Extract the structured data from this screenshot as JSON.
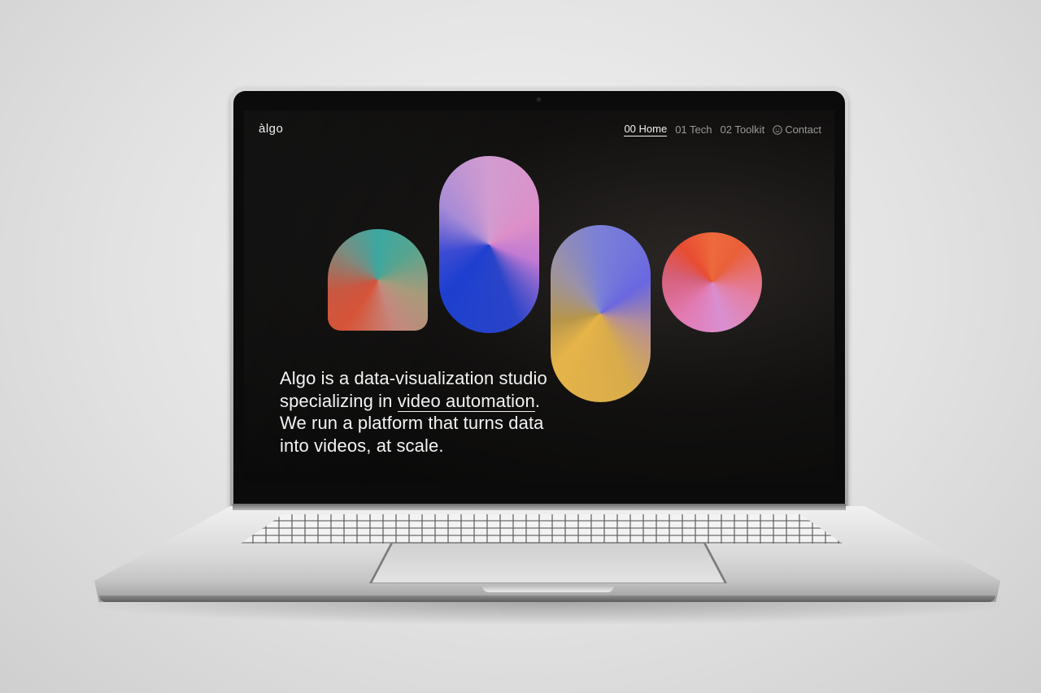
{
  "site": {
    "logo": "àlgo",
    "nav": [
      {
        "label": "00 Home",
        "active": true
      },
      {
        "label": "01 Tech",
        "active": false
      },
      {
        "label": "02 Toolkit",
        "active": false
      },
      {
        "label": "Contact",
        "active": false,
        "icon": "smile-icon"
      }
    ],
    "tagline": {
      "line1": "Algo is a data-visualization studio",
      "line2_prefix": "specializing in ",
      "line2_link": "video automation",
      "line2_suffix": ".",
      "line3": "We run a platform that turns data",
      "line4": "into videos, at scale."
    }
  },
  "colors": {
    "screen_background": "#0b0b0b",
    "text_primary": "#f3f3f3",
    "nav_inactive": "#9a9a9a"
  },
  "shapes": [
    {
      "name": "arch-shape",
      "colors": [
        "#3aa7a0",
        "#d65236"
      ]
    },
    {
      "name": "pill-shape-blue",
      "colors": [
        "#d29cd0",
        "#1d3fcf"
      ]
    },
    {
      "name": "pill-shape-gold",
      "colors": [
        "#6a67e0",
        "#e6b449"
      ]
    },
    {
      "name": "circle-shape",
      "colors": [
        "#ee6a3c",
        "#d98fd1"
      ]
    }
  ]
}
